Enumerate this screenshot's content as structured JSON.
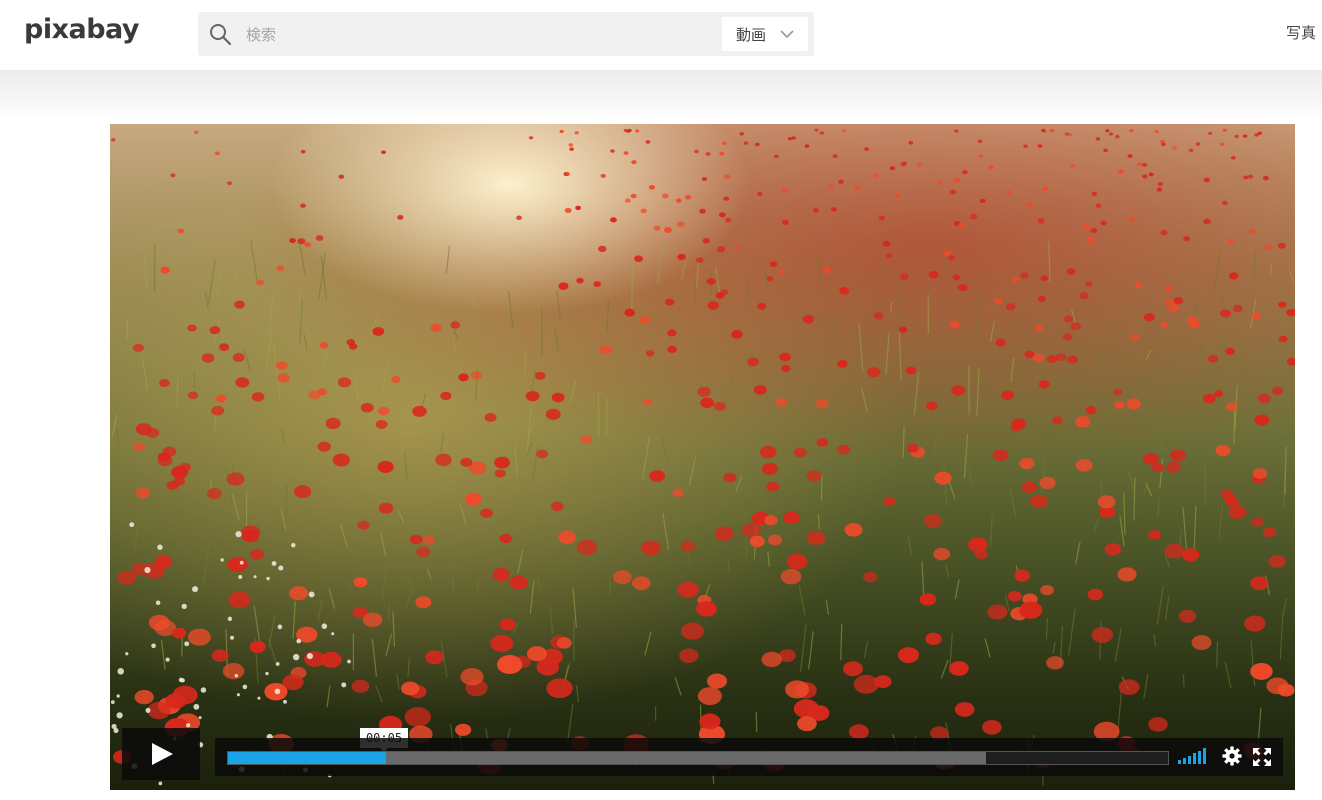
{
  "header": {
    "logo": "pixabay",
    "search": {
      "placeholder": "検索",
      "value": ""
    },
    "media_type": "動画",
    "nav_photos": "写真"
  },
  "player": {
    "current_time": "00:05",
    "played_fraction": 0.168,
    "loaded_fraction": 0.806,
    "volume_level": "full",
    "accent_color": "#1aa4e8"
  },
  "icons": [
    "search-icon",
    "chevron-down-icon",
    "play-icon",
    "volume-icon",
    "gear-icon",
    "fullscreen-icon"
  ]
}
